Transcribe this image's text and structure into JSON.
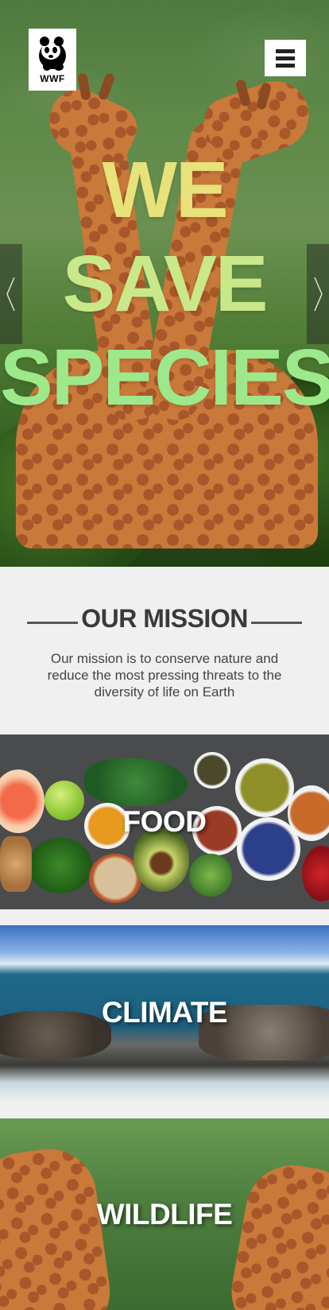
{
  "header": {
    "logo_text": "WWF",
    "menu_icon": "hamburger-icon"
  },
  "hero": {
    "title_lines": [
      "WE",
      "SAVE",
      "SPECIES"
    ],
    "colors": {
      "line1": "#e8e27a",
      "line2": "#c9e88a",
      "line3": "#9de88a"
    },
    "prev_icon": "chevron-left-icon",
    "next_icon": "chevron-right-icon"
  },
  "mission": {
    "heading": "OUR MISSION",
    "text": "Our mission is to conserve nature and reduce the most pressing threats to the diversity of life on Earth"
  },
  "cards": [
    {
      "label": "FOOD"
    },
    {
      "label": "CLIMATE"
    },
    {
      "label": "WILDLIFE"
    }
  ]
}
